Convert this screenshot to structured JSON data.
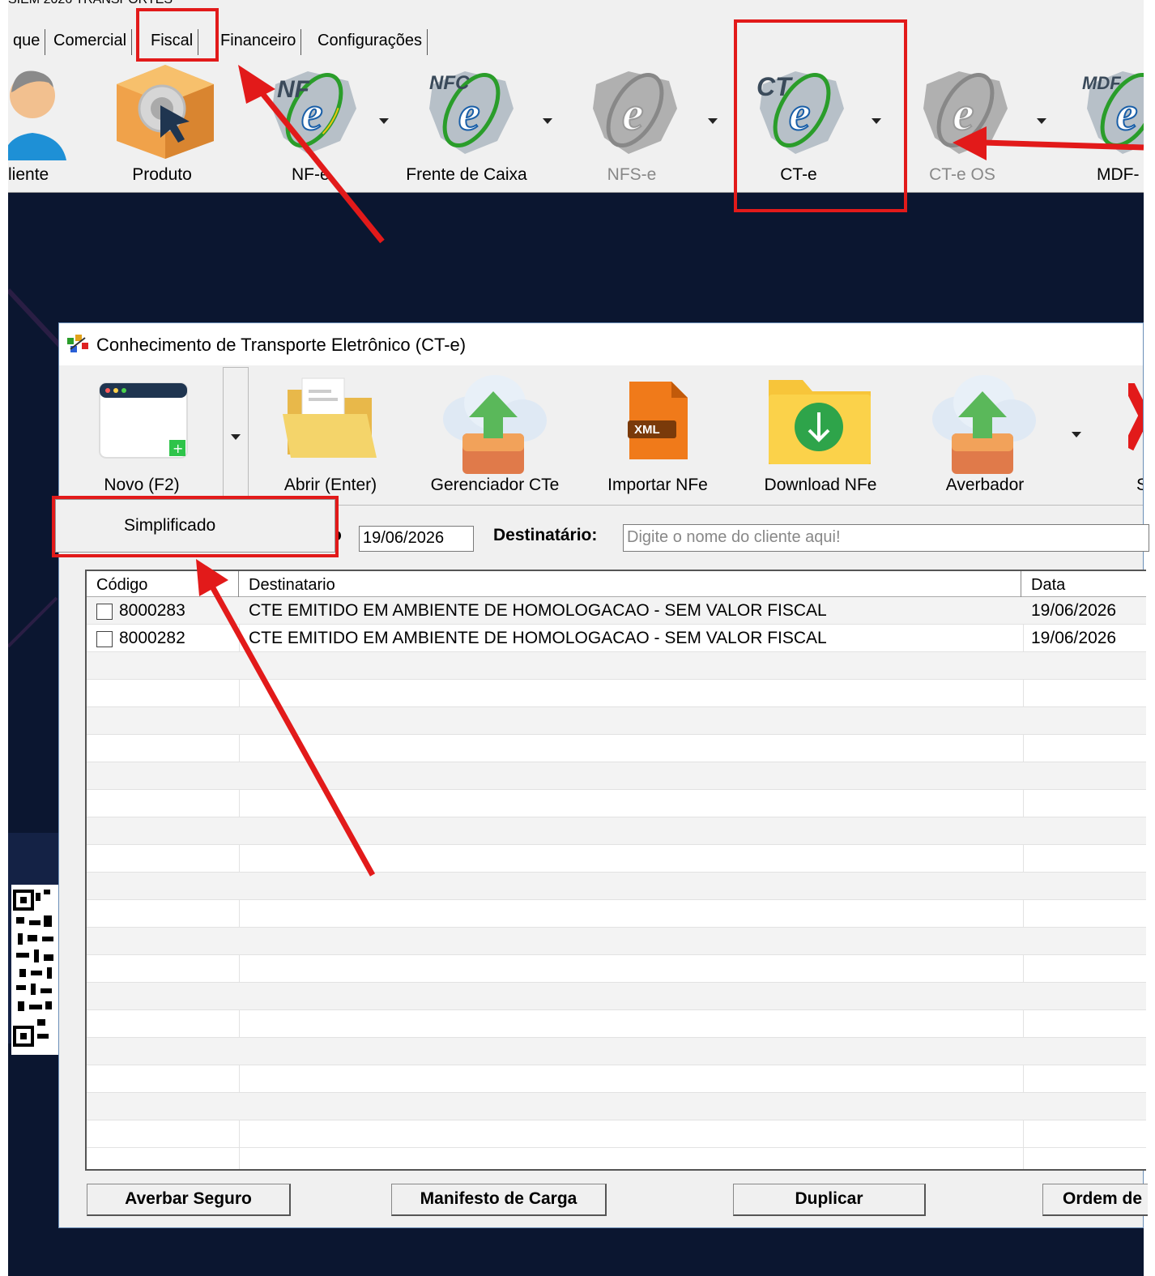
{
  "app": {
    "titlebar_fragment": "SIEM 2026 TRANSPORTES",
    "tabs": [
      "que",
      "Comercial",
      "Fiscal",
      "Financeiro",
      "Configurações"
    ]
  },
  "ribbon": {
    "items": [
      {
        "label": "liente",
        "icon": "user-icon",
        "enabled": true
      },
      {
        "label": "Produto",
        "icon": "product-box-icon",
        "enabled": true
      },
      {
        "label": "NF-e",
        "icon": "nfe-logo-icon",
        "enabled": true,
        "icon_text": "NF"
      },
      {
        "label": "Frente de Caixa",
        "icon": "nfce-logo-icon",
        "enabled": true,
        "icon_text": "NFC"
      },
      {
        "label": "NFS-e",
        "icon": "nfse-logo-icon",
        "enabled": false
      },
      {
        "label": "CT-e",
        "icon": "cte-logo-icon",
        "enabled": true,
        "icon_text": "CT"
      },
      {
        "label": "CT-e OS",
        "icon": "cteos-logo-icon",
        "enabled": false
      },
      {
        "label": "MDF-",
        "icon": "mdfe-logo-icon",
        "enabled": true,
        "icon_text": "MDF"
      }
    ]
  },
  "dialog": {
    "title": "Conhecimento de Transporte Eletrônico (CT-e)",
    "toolbar": [
      {
        "label": "Novo (F2)",
        "icon": "new-window-icon"
      },
      {
        "label": "Abrir (Enter)",
        "icon": "folder-open-icon"
      },
      {
        "label": "Gerenciador CTe",
        "icon": "cloud-upload-icon"
      },
      {
        "label": "Importar NFe",
        "icon": "xml-file-icon",
        "icon_text": "XML"
      },
      {
        "label": "Download NFe",
        "icon": "folder-download-icon"
      },
      {
        "label": "Averbador",
        "icon": "cloud-upload-icon"
      },
      {
        "label": "S",
        "icon": "close-icon"
      }
    ],
    "dropdown_menu": {
      "item": "Simplificado"
    },
    "filter": {
      "date_label": "o",
      "date_value": "19/06/2026",
      "dest_label": "Destinatário:",
      "dest_placeholder": "Digite o nome do cliente aqui!"
    },
    "grid": {
      "headers": [
        "Código",
        "Destinatario",
        "Data"
      ],
      "rows": [
        {
          "codigo": "8000283",
          "destinatario": "CTE EMITIDO EM AMBIENTE DE HOMOLOGACAO - SEM VALOR FISCAL",
          "data": "19/06/2026"
        },
        {
          "codigo": "8000282",
          "destinatario": "CTE EMITIDO EM AMBIENTE DE HOMOLOGACAO - SEM VALOR FISCAL",
          "data": "19/06/2026"
        }
      ]
    },
    "buttons": [
      "Averbar Seguro",
      "Manifesto de Carga",
      "Duplicar",
      "Ordem de"
    ]
  },
  "colors": {
    "highlight": "#e21a1a",
    "desktop": "#0b1630",
    "panel": "#f0f0f0"
  }
}
